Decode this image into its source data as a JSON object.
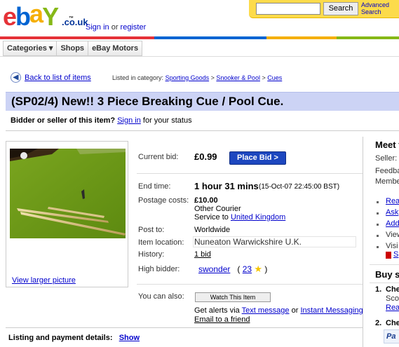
{
  "header": {
    "logo_letters": [
      "e",
      "b",
      "a",
      "Y"
    ],
    "tm": "™",
    "tld": ".co.uk",
    "signin_prefix": "Sign in",
    "signin_or": "or",
    "register": "register",
    "search_value": "",
    "search_button": "Search",
    "advanced_line1": "Advanced",
    "advanced_line2": "Search"
  },
  "nav": {
    "tabs": [
      "Categories ▾",
      "Shops",
      "eBay Motors"
    ]
  },
  "breadcrumb": {
    "back": "Back to list of items",
    "listed_in": "Listed in category:",
    "crumbs": [
      "Sporting Goods",
      "Snooker & Pool",
      "Cues"
    ],
    "separator": ">"
  },
  "title": "(SP02/4) New!! 3 Piece Breaking Cue / Pool Cue.",
  "status": {
    "question": "Bidder or seller of this item?",
    "signin": "Sign in",
    "suffix": "for your status"
  },
  "image": {
    "view_larger": "View larger picture"
  },
  "details": {
    "current_bid_label": "Current bid:",
    "current_bid": "£0.99",
    "place_bid": "Place Bid >",
    "end_time_label": "End time:",
    "end_time": "1 hour 31 mins",
    "end_time_date": "(15-Oct-07 22:45:00 BST)",
    "postage_label": "Postage costs:",
    "postage_cost": "£10.00",
    "postage_service": "Other Courier",
    "service_to": "Service to",
    "service_country": "United Kingdom",
    "post_to_label": "Post to:",
    "post_to": "Worldwide",
    "location_label": "Item location:",
    "location": "Nuneaton Warwickshire U.K.",
    "history_label": "History:",
    "history": "1 bid",
    "high_bidder_label": "High bidder:",
    "high_bidder": "swonder",
    "feedback_open": "(",
    "feedback_score": "23",
    "feedback_close": ")",
    "you_can_also_label": "You can also:",
    "watch_button": "Watch This Item",
    "alerts_prefix": "Get alerts via",
    "alerts_sms": "Text message",
    "alerts_or": "or",
    "alerts_im": "Instant Messaging",
    "email_friend": "Email to a friend"
  },
  "listing": {
    "label": "Listing and payment details:",
    "show": "Show"
  },
  "right": {
    "heading": "Meet t",
    "seller": "Seller:",
    "feedback": "Feedba",
    "member": "Membe",
    "links": [
      "Rea",
      "Ask",
      "Add",
      "View",
      "Visi"
    ],
    "store_link": "S",
    "buy_heading": "Buy s",
    "step1_num": "1.",
    "step1": "Che",
    "step1_text": "Sco",
    "step1_link": "Rea",
    "step2_num": "2.",
    "step2": "Che",
    "paypal": "Pa"
  },
  "colors": {
    "accent_blue": "#1d47bf",
    "title_bg": "#ccd3f5",
    "search_bg": "#fcdb4b"
  }
}
